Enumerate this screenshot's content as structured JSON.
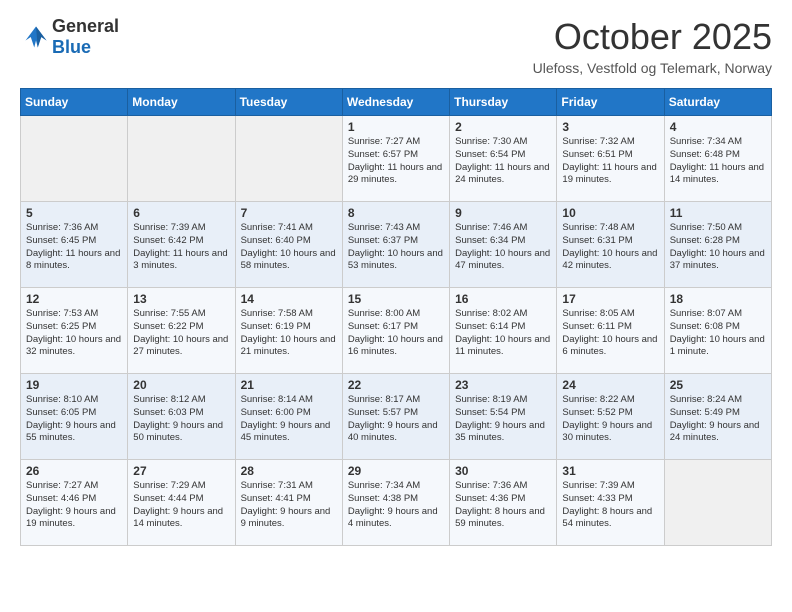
{
  "header": {
    "logo_general": "General",
    "logo_blue": "Blue",
    "month_title": "October 2025",
    "location": "Ulefoss, Vestfold og Telemark, Norway"
  },
  "weekdays": [
    "Sunday",
    "Monday",
    "Tuesday",
    "Wednesday",
    "Thursday",
    "Friday",
    "Saturday"
  ],
  "weeks": [
    [
      {
        "day": null,
        "info": null
      },
      {
        "day": null,
        "info": null
      },
      {
        "day": null,
        "info": null
      },
      {
        "day": "1",
        "info": "Sunrise: 7:27 AM\nSunset: 6:57 PM\nDaylight: 11 hours and 29 minutes."
      },
      {
        "day": "2",
        "info": "Sunrise: 7:30 AM\nSunset: 6:54 PM\nDaylight: 11 hours and 24 minutes."
      },
      {
        "day": "3",
        "info": "Sunrise: 7:32 AM\nSunset: 6:51 PM\nDaylight: 11 hours and 19 minutes."
      },
      {
        "day": "4",
        "info": "Sunrise: 7:34 AM\nSunset: 6:48 PM\nDaylight: 11 hours and 14 minutes."
      }
    ],
    [
      {
        "day": "5",
        "info": "Sunrise: 7:36 AM\nSunset: 6:45 PM\nDaylight: 11 hours and 8 minutes."
      },
      {
        "day": "6",
        "info": "Sunrise: 7:39 AM\nSunset: 6:42 PM\nDaylight: 11 hours and 3 minutes."
      },
      {
        "day": "7",
        "info": "Sunrise: 7:41 AM\nSunset: 6:40 PM\nDaylight: 10 hours and 58 minutes."
      },
      {
        "day": "8",
        "info": "Sunrise: 7:43 AM\nSunset: 6:37 PM\nDaylight: 10 hours and 53 minutes."
      },
      {
        "day": "9",
        "info": "Sunrise: 7:46 AM\nSunset: 6:34 PM\nDaylight: 10 hours and 47 minutes."
      },
      {
        "day": "10",
        "info": "Sunrise: 7:48 AM\nSunset: 6:31 PM\nDaylight: 10 hours and 42 minutes."
      },
      {
        "day": "11",
        "info": "Sunrise: 7:50 AM\nSunset: 6:28 PM\nDaylight: 10 hours and 37 minutes."
      }
    ],
    [
      {
        "day": "12",
        "info": "Sunrise: 7:53 AM\nSunset: 6:25 PM\nDaylight: 10 hours and 32 minutes."
      },
      {
        "day": "13",
        "info": "Sunrise: 7:55 AM\nSunset: 6:22 PM\nDaylight: 10 hours and 27 minutes."
      },
      {
        "day": "14",
        "info": "Sunrise: 7:58 AM\nSunset: 6:19 PM\nDaylight: 10 hours and 21 minutes."
      },
      {
        "day": "15",
        "info": "Sunrise: 8:00 AM\nSunset: 6:17 PM\nDaylight: 10 hours and 16 minutes."
      },
      {
        "day": "16",
        "info": "Sunrise: 8:02 AM\nSunset: 6:14 PM\nDaylight: 10 hours and 11 minutes."
      },
      {
        "day": "17",
        "info": "Sunrise: 8:05 AM\nSunset: 6:11 PM\nDaylight: 10 hours and 6 minutes."
      },
      {
        "day": "18",
        "info": "Sunrise: 8:07 AM\nSunset: 6:08 PM\nDaylight: 10 hours and 1 minute."
      }
    ],
    [
      {
        "day": "19",
        "info": "Sunrise: 8:10 AM\nSunset: 6:05 PM\nDaylight: 9 hours and 55 minutes."
      },
      {
        "day": "20",
        "info": "Sunrise: 8:12 AM\nSunset: 6:03 PM\nDaylight: 9 hours and 50 minutes."
      },
      {
        "day": "21",
        "info": "Sunrise: 8:14 AM\nSunset: 6:00 PM\nDaylight: 9 hours and 45 minutes."
      },
      {
        "day": "22",
        "info": "Sunrise: 8:17 AM\nSunset: 5:57 PM\nDaylight: 9 hours and 40 minutes."
      },
      {
        "day": "23",
        "info": "Sunrise: 8:19 AM\nSunset: 5:54 PM\nDaylight: 9 hours and 35 minutes."
      },
      {
        "day": "24",
        "info": "Sunrise: 8:22 AM\nSunset: 5:52 PM\nDaylight: 9 hours and 30 minutes."
      },
      {
        "day": "25",
        "info": "Sunrise: 8:24 AM\nSunset: 5:49 PM\nDaylight: 9 hours and 24 minutes."
      }
    ],
    [
      {
        "day": "26",
        "info": "Sunrise: 7:27 AM\nSunset: 4:46 PM\nDaylight: 9 hours and 19 minutes."
      },
      {
        "day": "27",
        "info": "Sunrise: 7:29 AM\nSunset: 4:44 PM\nDaylight: 9 hours and 14 minutes."
      },
      {
        "day": "28",
        "info": "Sunrise: 7:31 AM\nSunset: 4:41 PM\nDaylight: 9 hours and 9 minutes."
      },
      {
        "day": "29",
        "info": "Sunrise: 7:34 AM\nSunset: 4:38 PM\nDaylight: 9 hours and 4 minutes."
      },
      {
        "day": "30",
        "info": "Sunrise: 7:36 AM\nSunset: 4:36 PM\nDaylight: 8 hours and 59 minutes."
      },
      {
        "day": "31",
        "info": "Sunrise: 7:39 AM\nSunset: 4:33 PM\nDaylight: 8 hours and 54 minutes."
      },
      {
        "day": null,
        "info": null
      }
    ]
  ]
}
